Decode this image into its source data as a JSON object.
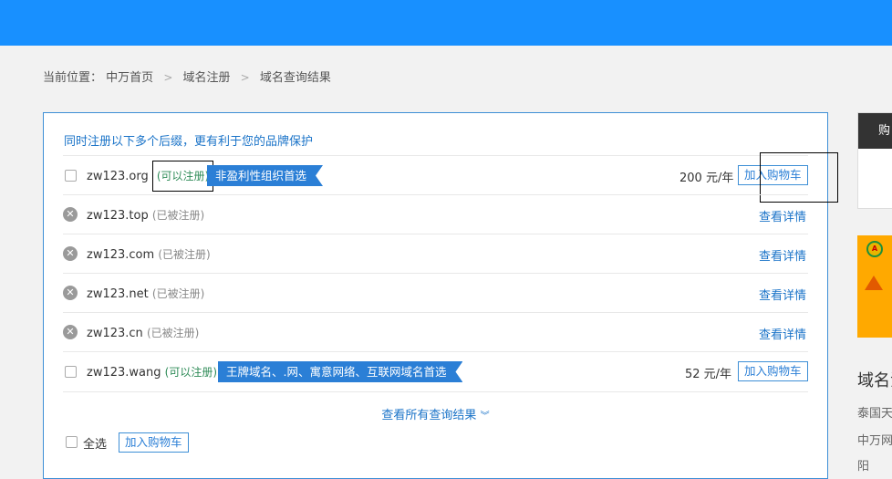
{
  "breadcrumb": {
    "label": "当前位置：",
    "items": [
      "中万首页",
      "域名注册",
      "域名查询结果"
    ],
    "separator": ">"
  },
  "panel": {
    "tip": "同时注册以下多个后缀，更有利于您的品牌保护",
    "rows": [
      {
        "domain": "zw123.org",
        "status": "(可以注册)",
        "tag": "非盈利性组织首选",
        "price": "200 元/年",
        "action": "加入购物车"
      },
      {
        "domain": "zw123.top",
        "status": "(已被注册)",
        "action": "查看详情"
      },
      {
        "domain": "zw123.com",
        "status": "(已被注册)",
        "action": "查看详情"
      },
      {
        "domain": "zw123.net",
        "status": "(已被注册)",
        "action": "查看详情"
      },
      {
        "domain": "zw123.cn",
        "status": "(已被注册)",
        "action": "查看详情"
      },
      {
        "domain": "zw123.wang",
        "status": "(可以注册)",
        "tag": "王牌域名、.网、寓意网络、互联网域名首选",
        "price": "52 元/年",
        "action": "加入购物车"
      }
    ],
    "view_all": "查看所有查询结果",
    "select_all": "全选",
    "footer_cart": "加入购物车"
  },
  "sidebar": {
    "cart_title": "购",
    "section_title": "域名注",
    "links": [
      "泰国天",
      "中万网",
      "阳"
    ]
  },
  "icons": {
    "unavailable": "close-circle-icon",
    "chevron": "chevron-double-down-icon"
  },
  "colors": {
    "topbar": "#1890ff",
    "accent": "#2b7fd6",
    "available": "#2e8b57",
    "banner": "#ffa900"
  }
}
